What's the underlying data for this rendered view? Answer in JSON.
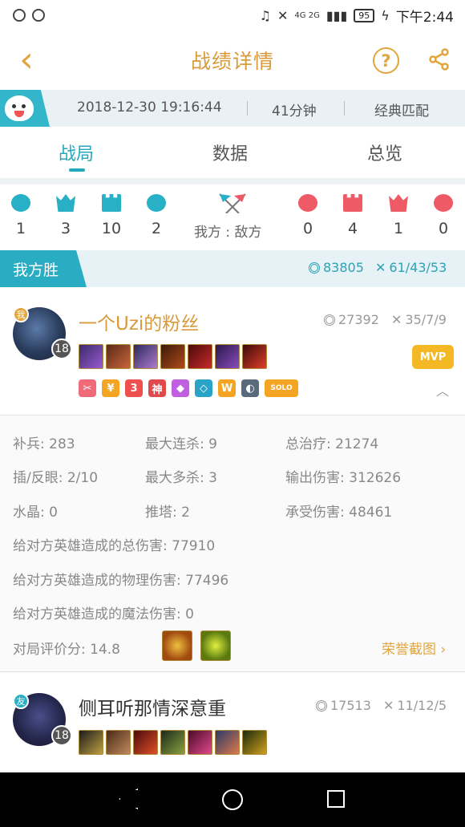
{
  "status_bar": {
    "network": "4G 2G",
    "battery": "95",
    "time": "下午2:44"
  },
  "header": {
    "title": "战绩详情",
    "back_icon": "chevron-left-icon",
    "help_label": "?",
    "share_icon": "share-icon",
    "accent_color": "#e2a53d"
  },
  "match_info": {
    "datetime": "2018-12-30 19:16:44",
    "duration": "41分钟",
    "mode": "经典匹配"
  },
  "tabs": [
    {
      "label": "战局",
      "active": true
    },
    {
      "label": "数据",
      "active": false
    },
    {
      "label": "总览",
      "active": false
    }
  ],
  "team_stats": {
    "ours": [
      "1",
      "3",
      "10",
      "2"
    ],
    "theirs": [
      "0",
      "4",
      "1",
      "0"
    ],
    "side_label": "我方 : 敌方",
    "our_color": "#27b0c6",
    "their_color": "#ee5b66"
  },
  "result": {
    "label": "我方胜",
    "gold": "83805",
    "kda": "61/43/53"
  },
  "players": [
    {
      "name": "一个Uzi的粉丝",
      "badge": "我",
      "level": "18",
      "gold": "27392",
      "kda": "35/7/9",
      "mvp": "MVP",
      "tags": [
        "✂",
        "¥",
        "3",
        "神",
        "◆",
        "◇",
        "W",
        "◐",
        "SOLO"
      ],
      "details": {
        "cs": "补兵: 283",
        "max_streak": "最大连杀: 9",
        "total_heal": "总治疗: 21274",
        "wards": "插/反眼: 2/10",
        "max_multikill": "最大多杀: 3",
        "damage_dealt": "输出伤害: 312626",
        "crystals": "水晶: 0",
        "towers": "推塔: 2",
        "damage_taken": "承受伤害: 48461",
        "champ_damage_total": "给对方英雄造成的总伤害: 77910",
        "champ_damage_physical": "给对方英雄造成的物理伤害: 77496",
        "champ_damage_magic": "给对方英雄造成的魔法伤害: 0",
        "rating": "对局评价分: 14.8",
        "honor_link": "荣誉截图"
      }
    },
    {
      "name": "侧耳听那情深意重",
      "badge": "友",
      "level": "18",
      "gold": "17513",
      "kda": "11/12/5"
    }
  ]
}
